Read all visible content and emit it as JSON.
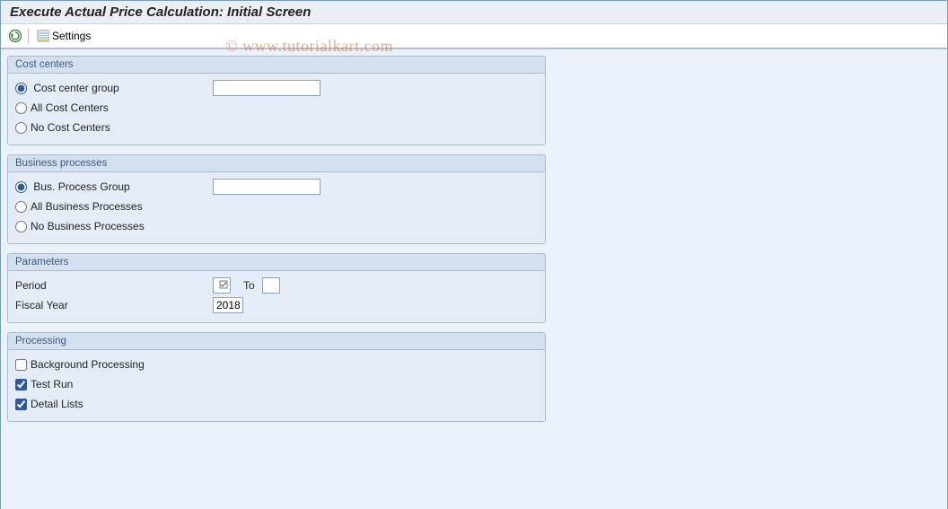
{
  "title": "Execute Actual Price Calculation: Initial Screen",
  "toolbar": {
    "settings_label": "Settings"
  },
  "watermark": "© www.tutorialkart.com",
  "groups": {
    "cost_centers": {
      "title": "Cost centers",
      "opt_group_label": "Cost center group",
      "opt_group_value": "",
      "opt_all_label": "All Cost Centers",
      "opt_none_label": "No Cost Centers",
      "selected": "group"
    },
    "business_processes": {
      "title": "Business processes",
      "opt_group_label": "Bus. Process Group",
      "opt_group_value": "",
      "opt_all_label": "All Business Processes",
      "opt_none_label": "No Business Processes",
      "selected": "group"
    },
    "parameters": {
      "title": "Parameters",
      "period_label": "Period",
      "period_from": "",
      "to_label": "To",
      "period_to": "",
      "fiscal_year_label": "Fiscal Year",
      "fiscal_year_value": "2018"
    },
    "processing": {
      "title": "Processing",
      "background_label": "Background Processing",
      "background_checked": false,
      "testrun_label": "Test Run",
      "testrun_checked": true,
      "detaillists_label": "Detail Lists",
      "detaillists_checked": true
    }
  }
}
